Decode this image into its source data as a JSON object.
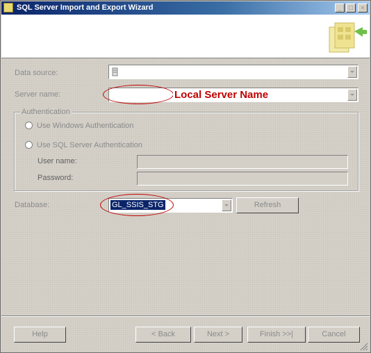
{
  "window": {
    "title": "SQL Server Import and Export Wizard"
  },
  "titlebar_buttons": {
    "minimize": "_",
    "maximize": "□",
    "close": "×"
  },
  "form": {
    "data_source_label": "Data source:",
    "server_name_label": "Server name:",
    "database_label": "Database:",
    "database_value": "GL_SSIS_STG",
    "refresh_label": "Refresh"
  },
  "authentication": {
    "group_label": "Authentication",
    "windows_auth_label": "Use Windows Authentication",
    "sql_auth_label": "Use SQL Server Authentication",
    "username_label": "User name:",
    "password_label": "Password:"
  },
  "annotation": {
    "text": "Local Server Name",
    "color": "#c00000"
  },
  "buttons": {
    "help": "Help",
    "back": "< Back",
    "next": "Next >",
    "finish": "Finish >>|",
    "cancel": "Cancel"
  }
}
